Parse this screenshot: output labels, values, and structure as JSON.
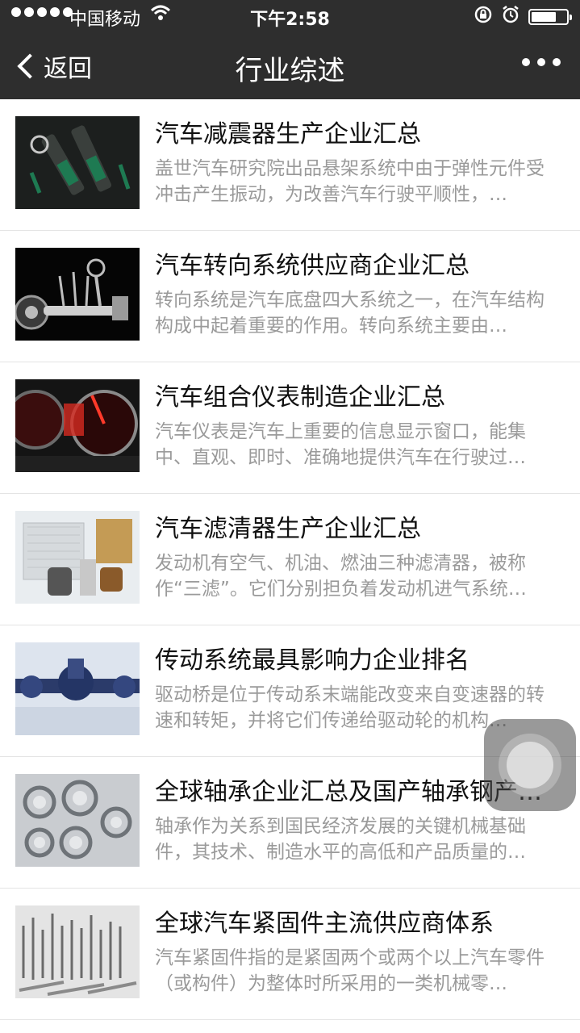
{
  "status_bar": {
    "carrier": "中国移动",
    "time": "下午2:58"
  },
  "nav": {
    "back_label": "返回",
    "title": "行业综述"
  },
  "articles": [
    {
      "title": "汽车减震器生产企业汇总",
      "summary": "盖世汽车研究院出品悬架系统中由于弹性元件受冲击产生振动，为改善汽车行驶平顺性，…",
      "thumb_icon": "shock-absorber-image"
    },
    {
      "title": "汽车转向系统供应商企业汇总",
      "summary": "转向系统是汽车底盘四大系统之一，在汽车结构构成中起着重要的作用。转向系统主要由…",
      "thumb_icon": "steering-system-image"
    },
    {
      "title": "汽车组合仪表制造企业汇总",
      "summary": "汽车仪表是汽车上重要的信息显示窗口，能集中、直观、即时、准确地提供汽车在行驶过…",
      "thumb_icon": "instrument-cluster-image"
    },
    {
      "title": "汽车滤清器生产企业汇总",
      "summary": "发动机有空气、机油、燃油三种滤清器，被称作“三滤”。它们分别担负着发动机进气系统…",
      "thumb_icon": "filters-image"
    },
    {
      "title": "传动系统最具影响力企业排名",
      "summary": "驱动桥是位于传动系末端能改变来自变速器的转速和转矩，并将它们传递给驱动轮的机构…",
      "thumb_icon": "drive-axle-image"
    },
    {
      "title": "全球轴承企业汇总及国产轴承钢产…",
      "summary": "轴承作为关系到国民经济发展的关键机械基础件，其技术、制造水平的高低和产品质量的…",
      "thumb_icon": "bearings-image"
    },
    {
      "title": "全球汽车紧固件主流供应商体系",
      "summary": "汽车紧固件指的是紧固两个或两个以上汽车零件（或构件）为整体时所采用的一类机械零…",
      "thumb_icon": "fasteners-image"
    }
  ],
  "colors": {
    "bar_bg": "#2e2e2e",
    "title_text": "#111111",
    "summary_text": "#9a9a9a",
    "divider": "#e4e4e4"
  }
}
